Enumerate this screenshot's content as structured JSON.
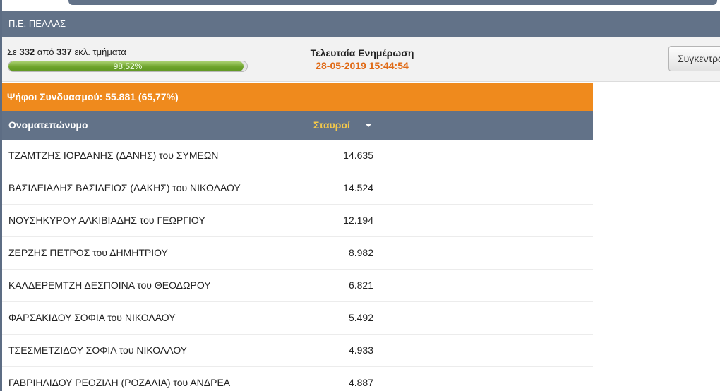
{
  "region": {
    "title": "Π.Ε. ΠΕΛΛΑΣ"
  },
  "stats": {
    "prefix": "Σε",
    "counted": "332",
    "of_label": "από",
    "total": "337",
    "suffix": "εκλ. τμήματα",
    "percent_label": "98,52%",
    "percent_value": 98.52
  },
  "update": {
    "label": "Τελευταία Ενημέρωση",
    "timestamp": "28-05-2019 15:44:54"
  },
  "aggregate_button": {
    "label": "Συγκεντρωτικά"
  },
  "coalition": {
    "votes_line": "Ψήφοι Συνδυασμού: 55.881 (65,77%)"
  },
  "table": {
    "col_name": "Ονοματεπώνυμο",
    "col_votes": "Σταυροί",
    "rows": [
      {
        "name": "ΤΖΑΜΤΖΗΣ ΙΟΡΔΑΝΗΣ (ΔΑΝΗΣ) του ΣΥΜΕΩΝ",
        "votes": "14.635"
      },
      {
        "name": "ΒΑΣΙΛΕΙΑΔΗΣ ΒΑΣΙΛΕΙΟΣ (ΛΑΚΗΣ) του ΝΙΚΟΛΑΟΥ",
        "votes": "14.524"
      },
      {
        "name": "ΝΟΥΣΗΚΥΡΟΥ ΑΛΚΙΒΙΑΔΗΣ του ΓΕΩΡΓΙΟΥ",
        "votes": "12.194"
      },
      {
        "name": "ΖΕΡΖΗΣ ΠΕΤΡΟΣ του ΔΗΜΗΤΡΙΟΥ",
        "votes": "8.982"
      },
      {
        "name": "ΚΑΛΔΕΡΕΜΤΖΗ ΔΕΣΠΟΙΝΑ του ΘΕΟΔΩΡΟΥ",
        "votes": "6.821"
      },
      {
        "name": "ΦΑΡΣΑΚΙΔΟΥ ΣΟΦΙΑ του ΝΙΚΟΛΑΟΥ",
        "votes": "5.492"
      },
      {
        "name": "ΤΣΕΣΜΕΤΖΙΔΟΥ ΣΟΦΙΑ του ΝΙΚΟΛΑΟΥ",
        "votes": "4.933"
      },
      {
        "name": "ΓΑΒΡΙΗΛΙΔΟΥ ΡΕΟΖΙΛΗ (ΡΟΖΑΛΙΑ) του ΑΝΔΡΕΑ",
        "votes": "4.887"
      }
    ]
  },
  "colors": {
    "header_bg": "#627288",
    "accent_orange": "#ef8a1d",
    "progress_green": "#6ea42c",
    "update_time": "#e06a16",
    "sort_column": "#f3c84a"
  },
  "icons": {
    "sort": "caret-down-icon"
  }
}
